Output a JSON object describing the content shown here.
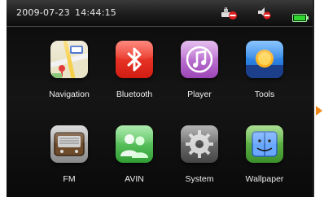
{
  "status": {
    "date": "2009-07-23",
    "time": "14:44:15",
    "tray_icons": [
      "usb-disconnected-icon",
      "mute-icon",
      "battery-icon"
    ],
    "battery_color": "#2fd62f"
  },
  "apps": [
    {
      "label": "Navigation",
      "icon": "map-icon"
    },
    {
      "label": "Bluetooth",
      "icon": "bluetooth-icon"
    },
    {
      "label": "Player",
      "icon": "music-note-icon"
    },
    {
      "label": "Tools",
      "icon": "sun-icon"
    },
    {
      "label": "FM",
      "icon": "radio-icon"
    },
    {
      "label": "AVIN",
      "icon": "people-icon"
    },
    {
      "label": "System",
      "icon": "gear-icon"
    },
    {
      "label": "Wallpaper",
      "icon": "finder-icon"
    }
  ],
  "pager": {
    "icon": "next-page-arrow-icon",
    "color": "#f08a1c"
  }
}
